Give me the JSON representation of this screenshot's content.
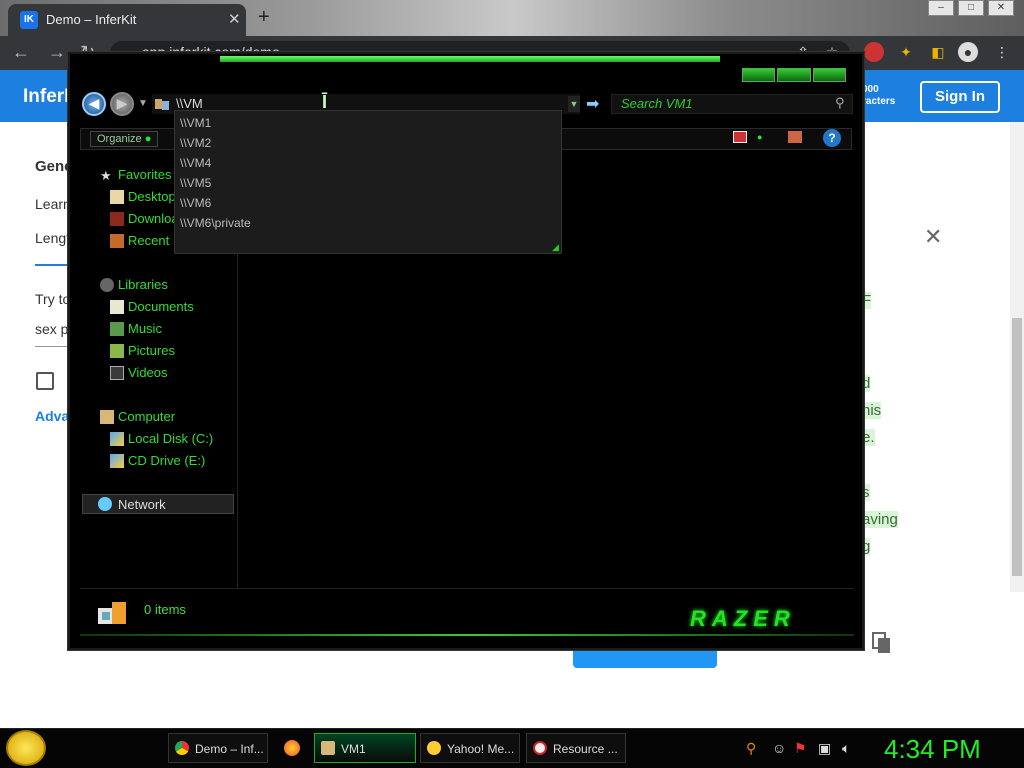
{
  "browser": {
    "tab_title": "Demo – InferKit",
    "tab_close": "✕",
    "new_tab": "+",
    "url": "app.inferkit.com/demo"
  },
  "site": {
    "brand": "InferK",
    "sign_in": "Sign In",
    "chars_line1": "000",
    "chars_line2": "racters",
    "left_texts": [
      "Gene",
      "Learn",
      "Lengt",
      "Try to",
      "sex p",
      "Advar"
    ],
    "right_highlights": [
      "F",
      "d",
      "his",
      "e.",
      "s",
      "aving",
      "g"
    ]
  },
  "explorer": {
    "address_value": "\\\\VM",
    "search_placeholder": "Search VM1",
    "organize": "Organize",
    "dropdown_items": [
      "\\\\VM1",
      "\\\\VM2",
      "\\\\VM4",
      "\\\\VM5",
      "\\\\VM6",
      "\\\\VM6\\private"
    ],
    "nav": {
      "favorites": "Favorites",
      "desktop": "Desktop",
      "downloads": "Downloa",
      "recent": "Recent",
      "libraries": "Libraries",
      "documents": "Documents",
      "music": "Music",
      "pictures": "Pictures",
      "videos": "Videos",
      "computer": "Computer",
      "local_disk": "Local Disk (C:)",
      "cd_drive": "CD Drive (E:)",
      "network": "Network"
    },
    "status_items": "0 items",
    "brand_logo": "RAZER"
  },
  "taskbar": {
    "buttons": [
      "Demo – Inf...",
      "VM1",
      "Yahoo! Me...",
      "Resource ..."
    ],
    "clock": "4:34 PM"
  }
}
